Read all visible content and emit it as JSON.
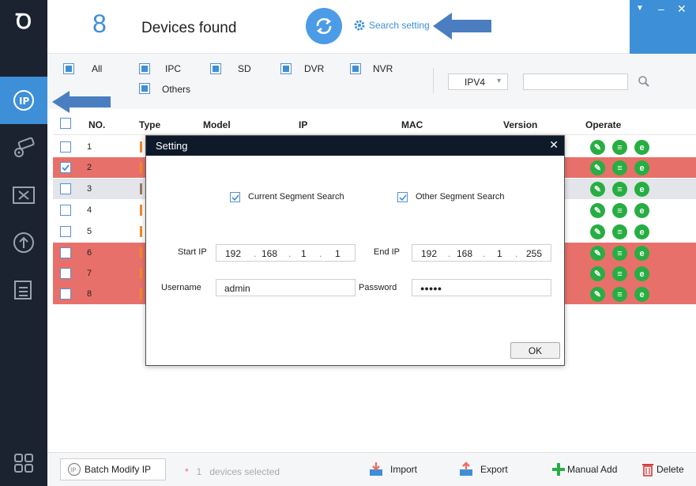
{
  "header": {
    "device_count": "8",
    "found_label": "Devices found",
    "search_setting_label": "Search setting",
    "logo_text": "Ꝺ"
  },
  "window_controls": {
    "pin": "▼",
    "minimize": "–",
    "close": "✕"
  },
  "sidebar": {
    "items": [
      {
        "name": "ip-search",
        "icon": "ip-icon",
        "active": true
      },
      {
        "name": "camera-config",
        "icon": "camera-gear-icon"
      },
      {
        "name": "tools",
        "icon": "tools-icon"
      },
      {
        "name": "upgrade",
        "icon": "upgrade-icon"
      },
      {
        "name": "docs",
        "icon": "document-icon"
      },
      {
        "name": "apps",
        "icon": "apps-icon"
      }
    ]
  },
  "filters": {
    "items": [
      {
        "label": "All",
        "checked": true
      },
      {
        "label": "IPC",
        "checked": true
      },
      {
        "label": "SD",
        "checked": true
      },
      {
        "label": "DVR",
        "checked": true
      },
      {
        "label": "NVR",
        "checked": true
      },
      {
        "label": "Others",
        "checked": true
      }
    ],
    "ip_version": "IPV4",
    "search_placeholder": ""
  },
  "table": {
    "headers": [
      "NO.",
      "Type",
      "Model",
      "IP",
      "MAC",
      "Version",
      "Operate"
    ],
    "rows": [
      {
        "no": "1",
        "state": "white",
        "checked": false
      },
      {
        "no": "2",
        "state": "red",
        "checked": true
      },
      {
        "no": "3",
        "state": "gray",
        "checked": false
      },
      {
        "no": "4",
        "state": "white",
        "checked": false
      },
      {
        "no": "5",
        "state": "white",
        "checked": false
      },
      {
        "no": "6",
        "state": "red",
        "checked": false
      },
      {
        "no": "7",
        "state": "red",
        "checked": false
      },
      {
        "no": "8",
        "state": "red",
        "checked": false
      }
    ],
    "op_icons": [
      "edit-icon",
      "details-icon",
      "browser-icon"
    ]
  },
  "modal": {
    "title": "Setting",
    "close": "✕",
    "current_segment_label": "Current Segment Search",
    "other_segment_label": "Other Segment Search",
    "start_ip_label": "Start IP",
    "start_ip": [
      "192",
      "168",
      "1",
      "1"
    ],
    "end_ip_label": "End IP",
    "end_ip": [
      "192",
      "168",
      "1",
      "255"
    ],
    "username_label": "Username",
    "username": "admin",
    "password_label": "Password",
    "password_masked": "●●●●●",
    "ok_label": "OK"
  },
  "footer": {
    "batch_label": "Batch Modify IP",
    "star": "*",
    "selected_count": "1",
    "selected_label": "devices selected",
    "import_label": "Import",
    "export_label": "Export",
    "manual_add_label": "Manual Add",
    "delete_label": "Delete"
  },
  "colors": {
    "accent": "#3d8fd8",
    "sidebar_bg": "#1b2330",
    "highlight_row": "#e8706a",
    "ok_green": "#27ae42"
  }
}
